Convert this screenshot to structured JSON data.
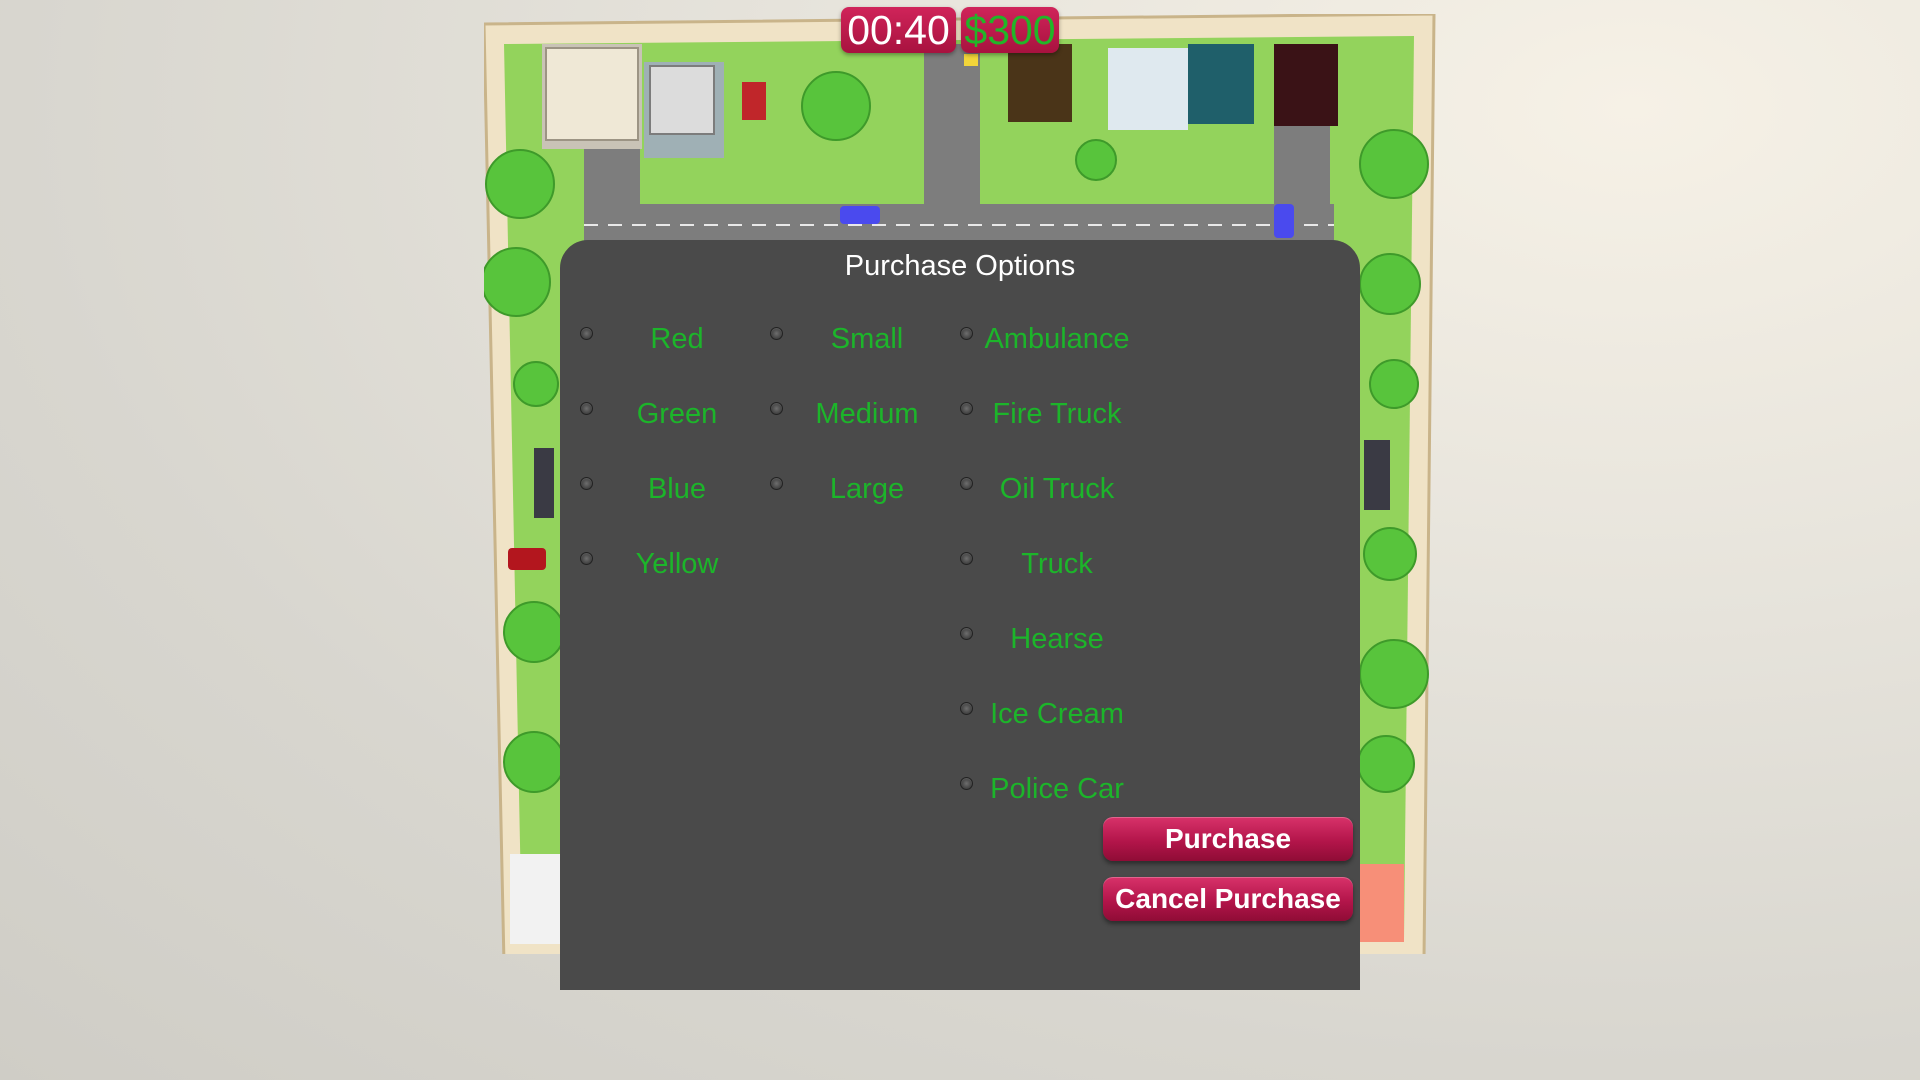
{
  "hud": {
    "timer": "00:40",
    "money": "$300"
  },
  "dialog": {
    "title": "Purchase Options",
    "colors": [
      {
        "label": "Red"
      },
      {
        "label": "Green"
      },
      {
        "label": "Blue"
      },
      {
        "label": "Yellow"
      }
    ],
    "sizes": [
      {
        "label": "Small"
      },
      {
        "label": "Medium"
      },
      {
        "label": "Large"
      }
    ],
    "vehicles": [
      {
        "label": "Ambulance"
      },
      {
        "label": "Fire Truck"
      },
      {
        "label": "Oil Truck"
      },
      {
        "label": "Truck"
      },
      {
        "label": "Hearse"
      },
      {
        "label": "Ice Cream"
      },
      {
        "label": "Police Car"
      }
    ],
    "purchase_label": "Purchase",
    "cancel_label": "Cancel Purchase"
  },
  "colors": {
    "hud_bg": "#b8184a",
    "option_text": "#1cb52a",
    "panel_bg": "#4a4a4a",
    "grass": "#8fd35a",
    "road": "#7d7d7d"
  }
}
